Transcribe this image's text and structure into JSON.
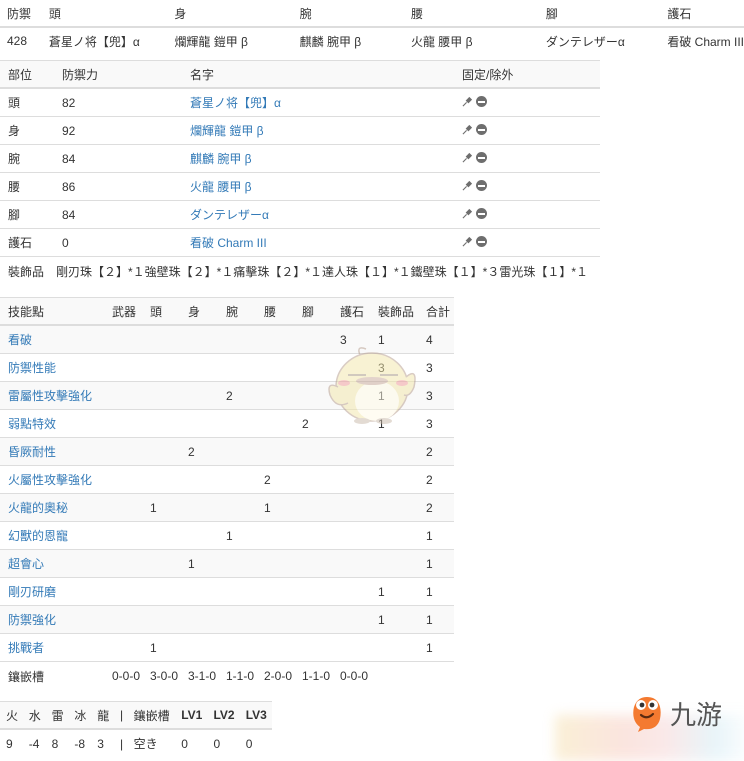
{
  "summary": {
    "headers": [
      "防禦",
      "頭",
      "身",
      "腕",
      "腰",
      "腳",
      "護石"
    ],
    "row": [
      "428",
      "蒼星ノ将【兜】α",
      "爛輝龍 鎧甲 β",
      "麒麟 腕甲 β",
      "火龍 腰甲 β",
      "ダンテレザーα",
      "看破 Charm III"
    ]
  },
  "armor": {
    "headers": {
      "part": "部位",
      "defense": "防禦力",
      "name": "名字",
      "actions": "固定/除外"
    },
    "rows": [
      {
        "part": "頭",
        "defense": "82",
        "name": "蒼星ノ将【兜】α"
      },
      {
        "part": "身",
        "defense": "92",
        "name": "爛輝龍 鎧甲 β"
      },
      {
        "part": "腕",
        "defense": "84",
        "name": "麒麟 腕甲 β"
      },
      {
        "part": "腰",
        "defense": "86",
        "name": "火龍 腰甲 β"
      },
      {
        "part": "腳",
        "defense": "84",
        "name": "ダンテレザーα"
      },
      {
        "part": "護石",
        "defense": "0",
        "name": "看破 Charm III"
      }
    ],
    "icons": {
      "pin": "pin-icon",
      "exclude": "minus-circle-icon"
    },
    "decorations_label": "裝飾品",
    "decorations": "剛刃珠【２】*１強壁珠【２】*１痛擊珠【２】*１達人珠【１】*１鐵壁珠【１】*３雷光珠【１】*１"
  },
  "skills": {
    "headers": [
      "技能點",
      "武器",
      "頭",
      "身",
      "腕",
      "腰",
      "腳",
      "護石",
      "裝飾品",
      "合計"
    ],
    "rows": [
      {
        "name": "看破",
        "cells": [
          "",
          "",
          "",
          "",
          "",
          "",
          "3",
          "1",
          "4"
        ]
      },
      {
        "name": "防禦性能",
        "cells": [
          "",
          "",
          "",
          "",
          "",
          "",
          "",
          "3",
          "3"
        ]
      },
      {
        "name": "雷屬性攻擊強化",
        "cells": [
          "",
          "",
          "",
          "2",
          "",
          "",
          "",
          "1",
          "3"
        ]
      },
      {
        "name": "弱點特效",
        "cells": [
          "",
          "",
          "",
          "",
          "",
          "2",
          "",
          "1",
          "3"
        ]
      },
      {
        "name": "昏厥耐性",
        "cells": [
          "",
          "",
          "2",
          "",
          "",
          "",
          "",
          "",
          "2"
        ]
      },
      {
        "name": "火屬性攻擊強化",
        "cells": [
          "",
          "",
          "",
          "",
          "2",
          "",
          "",
          "",
          "2"
        ]
      },
      {
        "name": "火龍的奧秘",
        "cells": [
          "",
          "1",
          "",
          "",
          "1",
          "",
          "",
          "",
          "2"
        ]
      },
      {
        "name": "幻獸的恩寵",
        "cells": [
          "",
          "",
          "",
          "1",
          "",
          "",
          "",
          "",
          "1"
        ]
      },
      {
        "name": "超會心",
        "cells": [
          "",
          "",
          "1",
          "",
          "",
          "",
          "",
          "",
          "1"
        ]
      },
      {
        "name": "剛刃研磨",
        "cells": [
          "",
          "",
          "",
          "",
          "",
          "",
          "",
          "1",
          "1"
        ]
      },
      {
        "name": "防禦強化",
        "cells": [
          "",
          "",
          "",
          "",
          "",
          "",
          "",
          "1",
          "1"
        ]
      },
      {
        "name": "挑戰者",
        "cells": [
          "",
          "1",
          "",
          "",
          "",
          "",
          "",
          "",
          "1"
        ]
      }
    ],
    "slots_label": "鑲嵌槽",
    "slots": [
      "0-0-0",
      "3-0-0",
      "3-1-0",
      "1-1-0",
      "2-0-0",
      "1-1-0",
      "0-0-0",
      "",
      ""
    ]
  },
  "resist": {
    "headers": [
      "火",
      "水",
      "雷",
      "冰",
      "龍",
      "|",
      "鑲嵌槽",
      "LV1",
      "LV2",
      "LV3"
    ],
    "row": [
      "9",
      "-4",
      "8",
      "-8",
      "3",
      "|",
      "空き",
      "0",
      "0",
      "0"
    ]
  },
  "watermark": {
    "logo_text": "九游",
    "mascot": "mascot-watermark"
  },
  "colors": {
    "link": "#337ab7",
    "text": "#333333",
    "border": "#dddddd",
    "stripe": "#f9f9f9",
    "logo_orange": "#f47a30"
  }
}
